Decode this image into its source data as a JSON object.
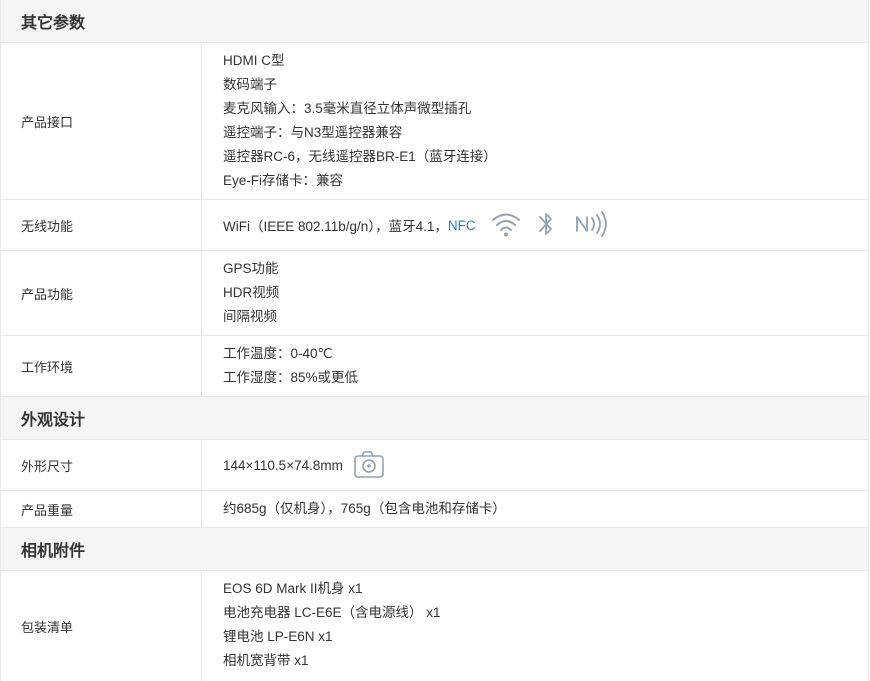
{
  "sections": {
    "other": {
      "title": "其它参数",
      "interfaces": {
        "label": "产品接口",
        "lines": [
          "HDMI C型",
          "数码端子",
          "麦克风输入：3.5毫米直径立体声微型插孔",
          "遥控端子：与N3型遥控器兼容",
          "遥控器RC-6，无线遥控器BR-E1（蓝牙连接）",
          "Eye-Fi存储卡：兼容"
        ]
      },
      "wireless": {
        "label": "无线功能",
        "text": "WiFi（IEEE 802.11b/g/n），蓝牙4.1，",
        "nfc": "NFC",
        "icons": [
          "wifi-icon",
          "bluetooth-icon",
          "nfc-icon"
        ]
      },
      "functions": {
        "label": "产品功能",
        "lines": [
          "GPS功能",
          "HDR视频",
          "间隔视频"
        ]
      },
      "environment": {
        "label": "工作环境",
        "lines": [
          "工作温度：0-40℃",
          "工作湿度：85%或更低"
        ]
      }
    },
    "design": {
      "title": "外观设计",
      "size": {
        "label": "外形尺寸",
        "text": "144×110.5×74.8mm",
        "icon": "camera-icon"
      },
      "weight": {
        "label": "产品重量",
        "text": "约685g（仅机身），765g（包含电池和存储卡）"
      }
    },
    "accessories": {
      "title": "相机附件",
      "package": {
        "label": "包装清单",
        "lines": [
          "EOS 6D Mark II机身 x1",
          "电池充电器 LC-E6E（含电源线） x1",
          "锂电池 LP-E6N x1",
          "相机宽背带 x1"
        ]
      }
    }
  },
  "colors": {
    "header_bg": "#f5f5f5",
    "border": "#e8e8e8",
    "text": "#333333",
    "link": "#1f8ad2",
    "icon": "#8fa3b3"
  }
}
